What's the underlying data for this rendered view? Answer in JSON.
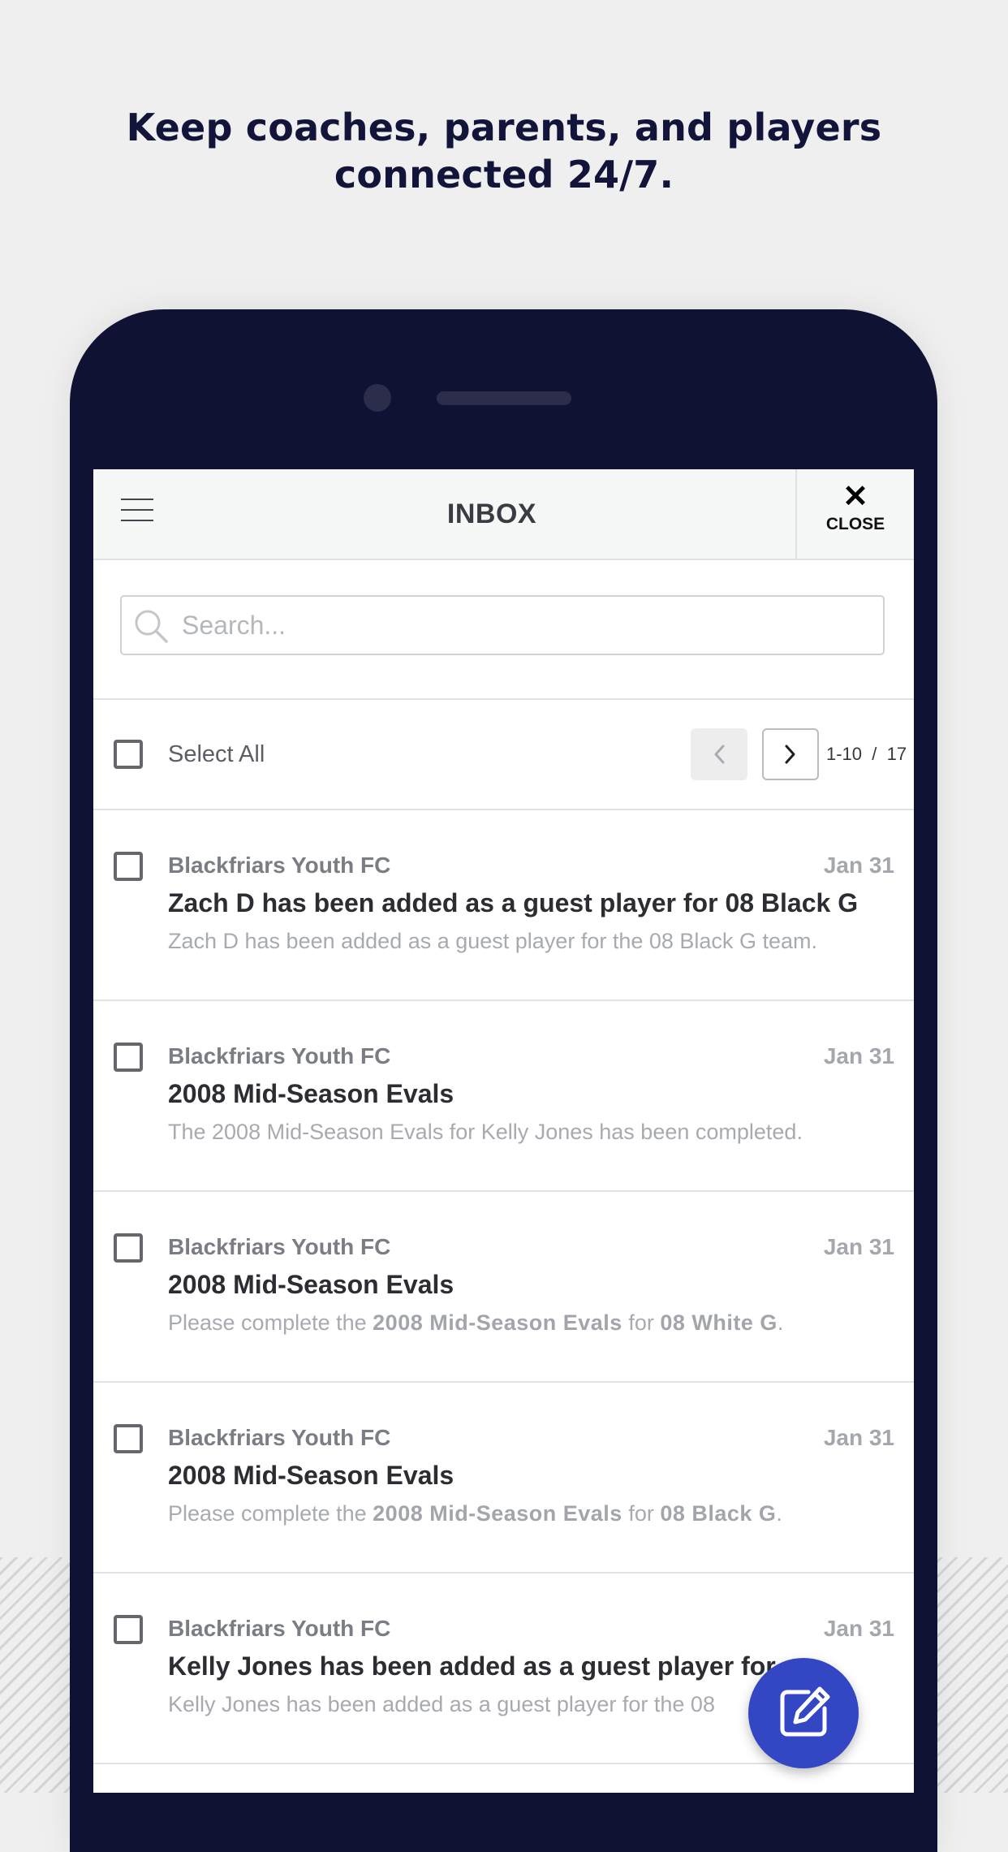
{
  "promo": {
    "line1": "Keep coaches, parents, and players",
    "line2": "connected 24/7."
  },
  "header": {
    "title": "INBOX",
    "close_label": "CLOSE",
    "close_glyph": "✕"
  },
  "search": {
    "placeholder": "Search...",
    "value": ""
  },
  "toolbar": {
    "select_all_label": "Select All",
    "page_range": "1-10  /  17"
  },
  "messages": [
    {
      "sender": "Blackfriars Youth FC",
      "date": "Jan 31",
      "subject": "Zach D has been added as a guest player for 08 Black G",
      "preview": "Zach D has been added as a guest player for the 08 Black G team."
    },
    {
      "sender": "Blackfriars Youth FC",
      "date": "Jan 31",
      "subject": "2008 Mid-Season Evals",
      "preview": "The 2008 Mid-Season Evals for Kelly Jones has been completed."
    },
    {
      "sender": "Blackfriars Youth FC",
      "date": "Jan 31",
      "subject": "2008 Mid-Season Evals",
      "preview_parts": [
        "Please complete the ",
        "2008 Mid-Season Evals",
        " for ",
        "08 White G",
        "."
      ]
    },
    {
      "sender": "Blackfriars Youth FC",
      "date": "Jan 31",
      "subject": "2008 Mid-Season Evals",
      "preview_parts": [
        "Please complete the ",
        "2008 Mid-Season Evals",
        " for ",
        "08 Black G",
        "."
      ]
    },
    {
      "sender": "Blackfriars Youth FC",
      "date": "Jan 31",
      "subject": "Kelly Jones has been added as a guest player for",
      "preview": "Kelly Jones has been added as a guest player for the 08"
    }
  ],
  "icons": {
    "menu": "hamburger-menu-icon",
    "close": "close-icon",
    "search": "search-icon",
    "prev": "chevron-left-icon",
    "next": "chevron-right-icon",
    "compose": "compose-icon"
  },
  "colors": {
    "phone_frame": "#101233",
    "headline": "#12143a",
    "fab": "#3347c4",
    "background": "#efefef"
  }
}
